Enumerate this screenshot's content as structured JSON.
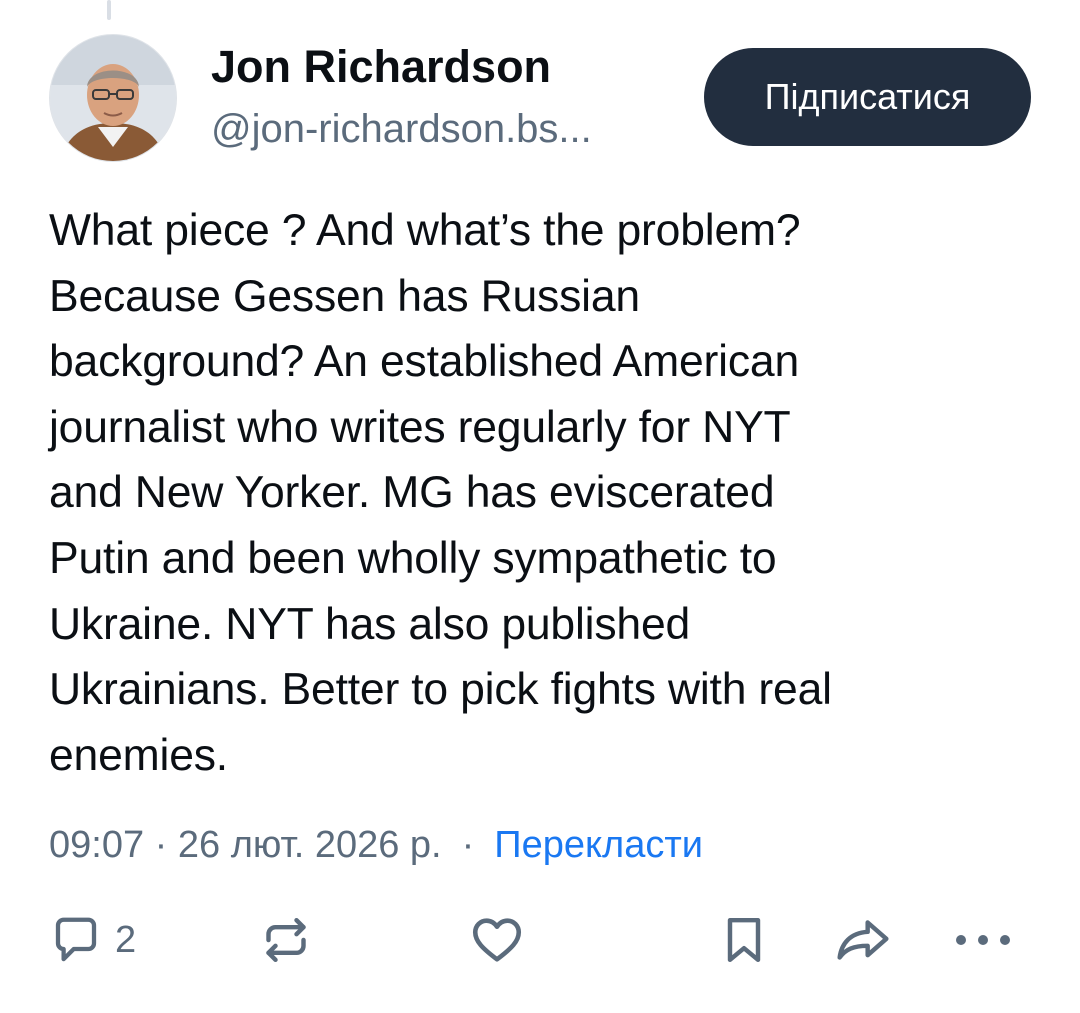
{
  "post": {
    "author": {
      "display_name": "Jon Richardson",
      "handle": "@jon-richardson.bs..."
    },
    "follow_label": "Підписатися",
    "text": "What piece ? And what’s the problem?\nBecause Gessen has Russian\nbackground? An established American\njournalist who writes regularly for NYT\nand New Yorker. MG has eviscerated\nPutin and been wholly sympathetic to\nUkraine. NYT has also published\nUkrainians. Better to pick fights with real\nenemies.",
    "timestamp": "09:07 · 26 лют. 2026 р.",
    "separator": "·",
    "translate_label": "Перекласти"
  },
  "actions": {
    "reply_count": "2",
    "icons": [
      "reply-icon",
      "repost-icon",
      "like-icon",
      "bookmark-icon",
      "share-icon",
      "more-icon"
    ]
  },
  "colors": {
    "follow_bg": "#222e3f",
    "secondary_text": "#5b6b7c",
    "link": "#1a78f2"
  }
}
